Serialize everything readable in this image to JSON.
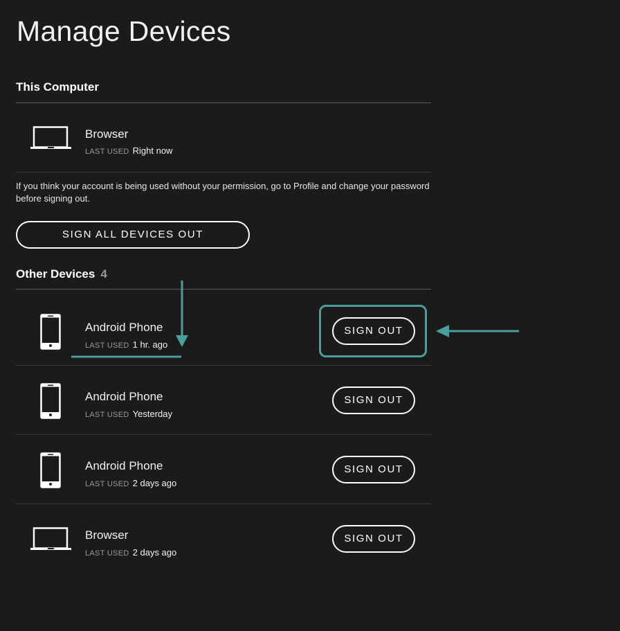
{
  "page": {
    "title": "Manage Devices"
  },
  "this_computer": {
    "heading": "This Computer",
    "device": {
      "name": "Browser",
      "icon": "laptop-icon",
      "last_used_label": "LAST USED",
      "last_used_value": "Right now"
    },
    "warning": "If you think your account is being used without your permission, go to Profile and change your password before signing out.",
    "sign_all_label": "SIGN ALL DEVICES OUT"
  },
  "other_devices": {
    "heading": "Other Devices",
    "count": "4",
    "items": [
      {
        "name": "Android Phone",
        "icon": "phone-icon",
        "last_used_label": "LAST USED",
        "last_used_value": "1 hr. ago",
        "button_label": "SIGN OUT"
      },
      {
        "name": "Android Phone",
        "icon": "phone-icon",
        "last_used_label": "LAST USED",
        "last_used_value": "Yesterday",
        "button_label": "SIGN OUT"
      },
      {
        "name": "Android Phone",
        "icon": "phone-icon",
        "last_used_label": "LAST USED",
        "last_used_value": "2 days ago",
        "button_label": "SIGN OUT"
      },
      {
        "name": "Browser",
        "icon": "laptop-icon",
        "last_used_label": "LAST USED",
        "last_used_value": "2 days ago",
        "button_label": "SIGN OUT"
      }
    ]
  },
  "colors": {
    "background": "#1b1b1b",
    "annotation_accent": "#4a9e9b",
    "text": "#ffffff",
    "muted": "#9a9a9a"
  }
}
